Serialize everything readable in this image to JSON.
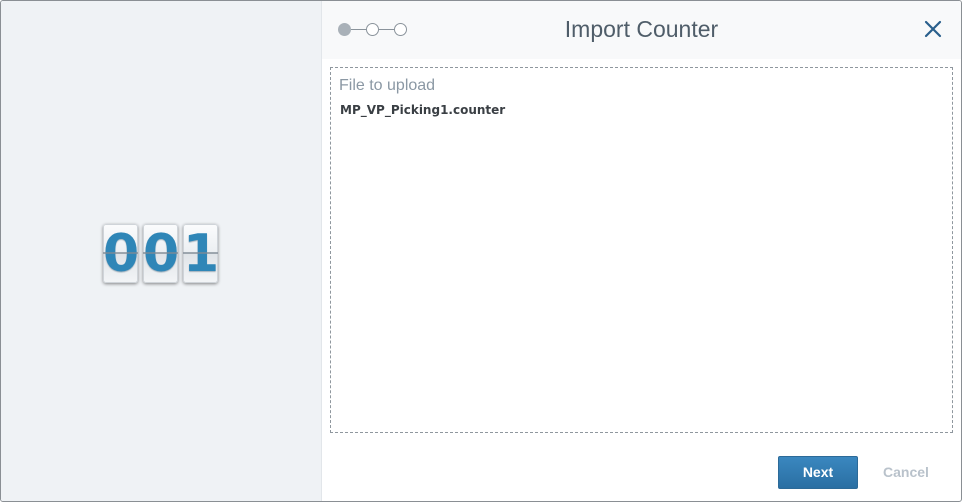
{
  "dialog": {
    "title": "Import Counter",
    "close_icon": "close-x-icon",
    "steps": [
      {
        "state": "active"
      },
      {
        "state": "inactive"
      },
      {
        "state": "inactive"
      }
    ]
  },
  "illustration": {
    "icon": "flip-counter-icon",
    "digits": [
      "0",
      "0",
      "1"
    ]
  },
  "upload": {
    "label": "File to upload",
    "file_name": "MP_VP_Picking1.counter"
  },
  "footer": {
    "next_label": "Next",
    "cancel_label": "Cancel"
  },
  "colors": {
    "accent": "#2f7db4",
    "title_text": "#4f5d69",
    "left_panel_bg": "#eff2f5",
    "cancel_disabled": "#b9c2cb"
  }
}
